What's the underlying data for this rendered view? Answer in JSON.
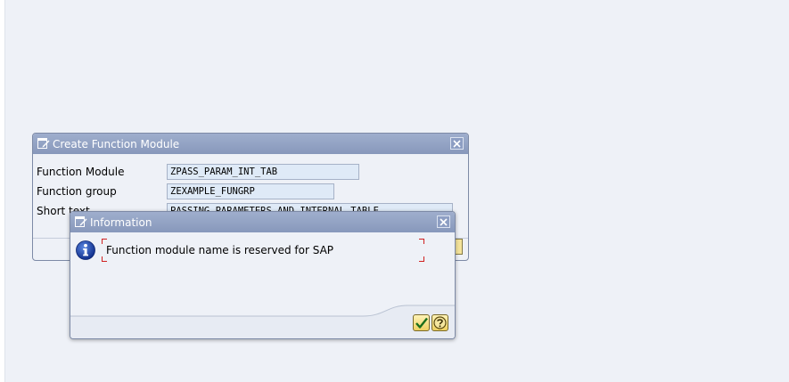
{
  "create_dialog": {
    "title": "Create Function Module",
    "fields": [
      {
        "label": "Function Module",
        "value": "ZPASS_PARAM_INT_TAB"
      },
      {
        "label": "Function group",
        "value": "ZEXAMPLE_FUNGRP"
      },
      {
        "label": "Short text",
        "value": "PASSING PARAMETERS AND INTERNAL TABLE"
      }
    ]
  },
  "info_dialog": {
    "title": "Information",
    "message": "Function module name is reserved for SAP"
  },
  "icons": {
    "window": "window-edit-icon",
    "close": "close-icon",
    "info": "info-icon",
    "ok": "checkmark-icon",
    "help": "help-icon"
  },
  "colors": {
    "titlebar": "#8d9ec3",
    "background": "#eef1f7",
    "input_bg": "#dfeaf7",
    "info_icon": "#1d3fa8",
    "message_frame": "#d02020",
    "button": "#eed060"
  }
}
